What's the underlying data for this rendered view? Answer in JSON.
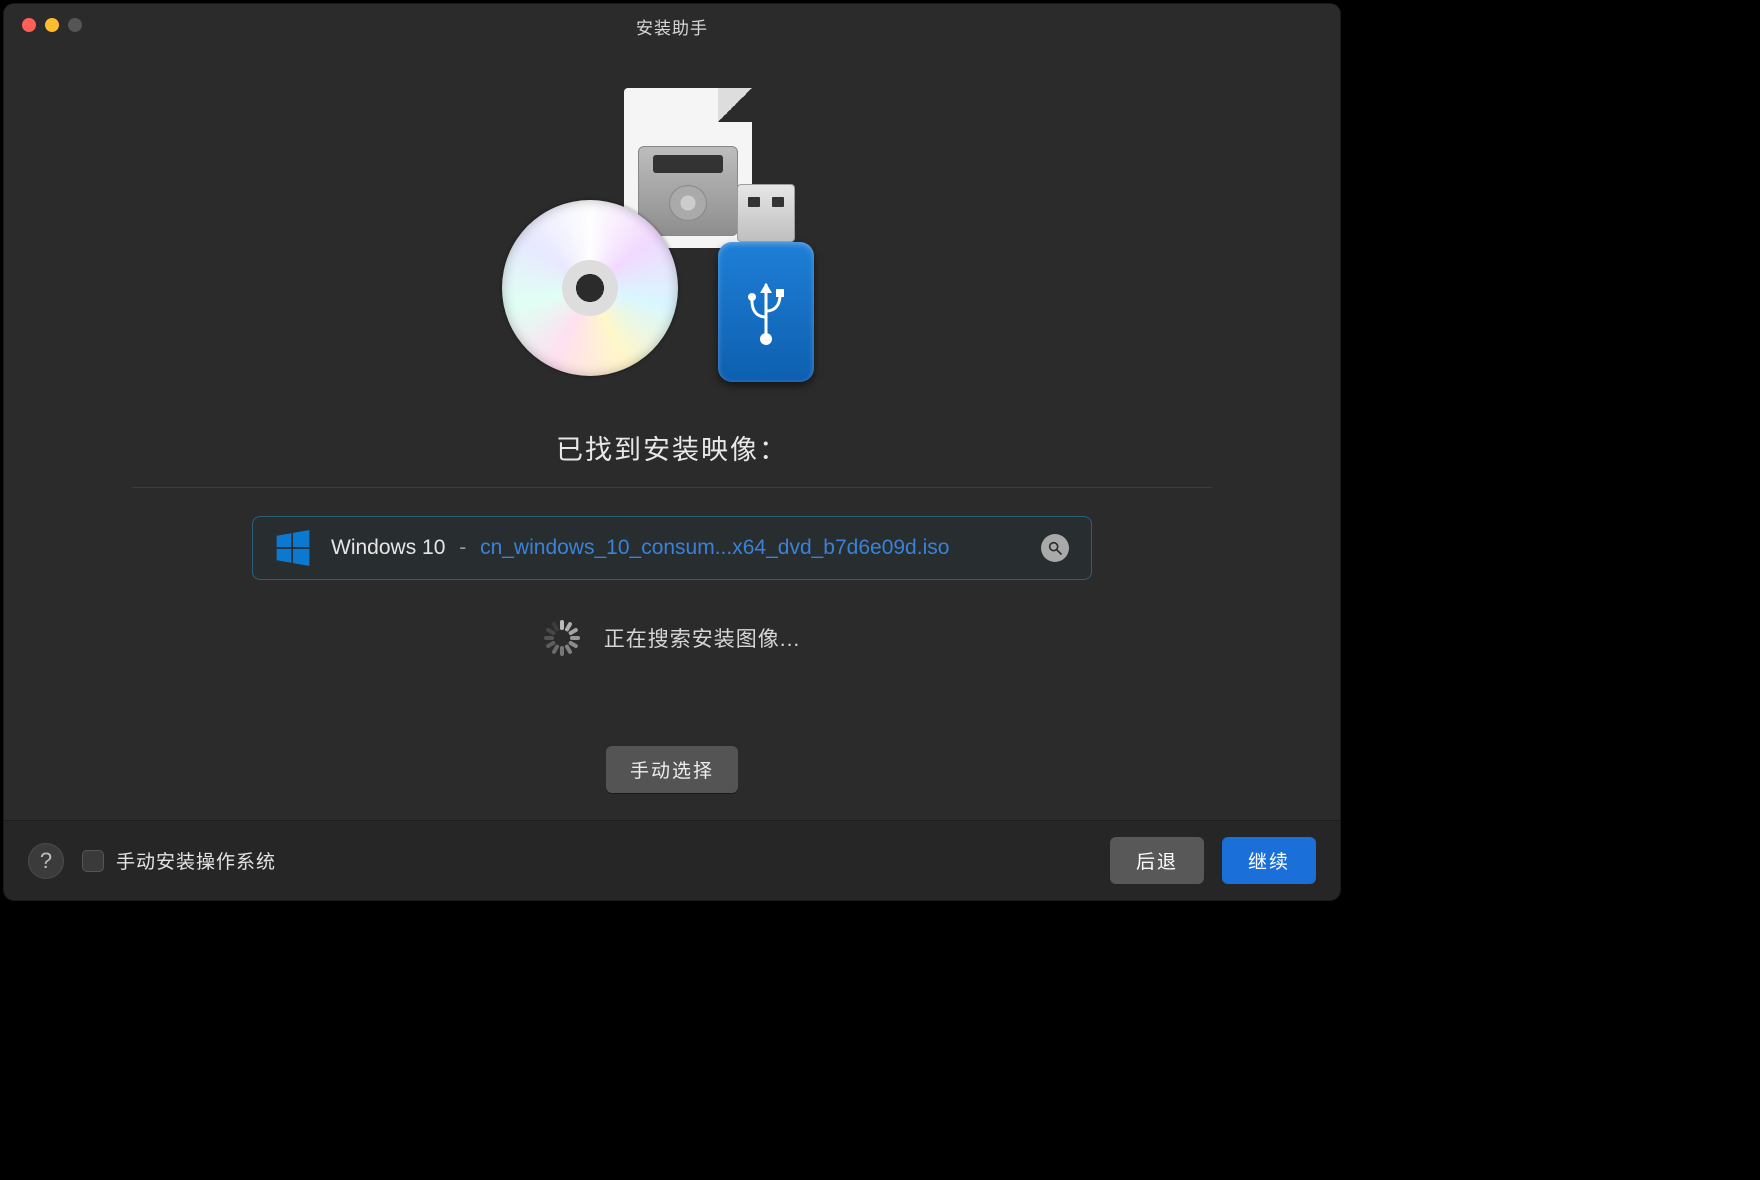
{
  "window": {
    "title": "安装助手"
  },
  "main": {
    "heading": "已找到安装映像：",
    "iso": {
      "os_name": "Windows 10",
      "separator": "-",
      "file_name": "cn_windows_10_consum...x64_dvd_b7d6e09d.iso"
    },
    "searching_label": "正在搜索安装图像...",
    "manual_select_button": "手动选择"
  },
  "footer": {
    "help_label": "?",
    "manual_install_checkbox_label": "手动安装操作系统",
    "manual_install_checked": false,
    "back_button": "后退",
    "continue_button": "继续"
  },
  "icons": {
    "windows_logo": "windows-logo",
    "magnifier": "magnifier-icon",
    "spinner": "spinner-icon",
    "usb_trident": "usb-icon",
    "hero": "install-media-icon"
  },
  "colors": {
    "accent": "#1a6fd8",
    "link": "#3a82d8",
    "bg": "#2b2b2b",
    "button_gray": "#585858"
  }
}
